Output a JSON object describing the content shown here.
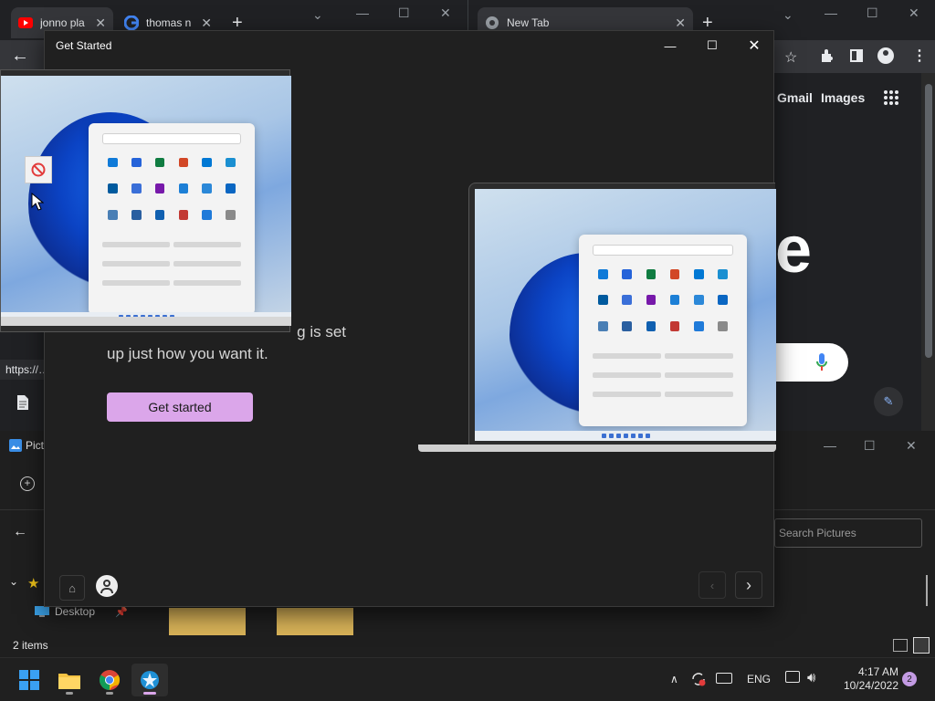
{
  "chrome_left": {
    "tabs": [
      {
        "title": "jonno pla",
        "icon": "youtube-icon"
      },
      {
        "title": "thomas n",
        "icon": "google-icon"
      }
    ],
    "status_url": "https://…"
  },
  "chrome_right": {
    "tab_title": "New Tab",
    "links": {
      "gmail": "Gmail",
      "images": "Images"
    },
    "logo_fragment": "e"
  },
  "explorer": {
    "title_fragment": "Pict",
    "search_placeholder": "Search Pictures",
    "nav_item": "Desktop",
    "status": "2 items"
  },
  "get_started": {
    "window_title": "Get Started",
    "body_text_line1": "g is set",
    "body_text_line2": "up just how you want it.",
    "cta_label": "Get started",
    "accent": "#dba6ea"
  },
  "taskbar": {
    "language": "ENG",
    "time": "4:17 AM",
    "date": "10/24/2022",
    "notification_count": "2"
  }
}
